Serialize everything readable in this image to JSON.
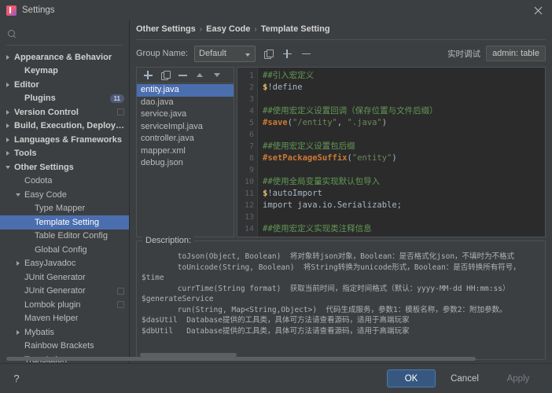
{
  "window": {
    "title": "Settings",
    "app_icon": "intellij-logo-icon",
    "close_icon": "close-icon"
  },
  "sidebar": {
    "search_placeholder": "",
    "search_icon": "search-icon",
    "items": [
      {
        "label": "Appearance & Behavior",
        "indent": 0,
        "arrow": "right",
        "bold": true
      },
      {
        "label": "Keymap",
        "indent": 1,
        "arrow": "none",
        "bold": true
      },
      {
        "label": "Editor",
        "indent": 0,
        "arrow": "right",
        "bold": true
      },
      {
        "label": "Plugins",
        "indent": 1,
        "arrow": "none",
        "bold": true,
        "badge": "11"
      },
      {
        "label": "Version Control",
        "indent": 0,
        "arrow": "right",
        "bold": true,
        "icon": "copy-icon"
      },
      {
        "label": "Build, Execution, Deployment",
        "indent": 0,
        "arrow": "right",
        "bold": true
      },
      {
        "label": "Languages & Frameworks",
        "indent": 0,
        "arrow": "right",
        "bold": true
      },
      {
        "label": "Tools",
        "indent": 0,
        "arrow": "right",
        "bold": true
      },
      {
        "label": "Other Settings",
        "indent": 0,
        "arrow": "down",
        "bold": true
      },
      {
        "label": "Codota",
        "indent": 1,
        "arrow": "none"
      },
      {
        "label": "Easy Code",
        "indent": 1,
        "arrow": "down"
      },
      {
        "label": "Type Mapper",
        "indent": 2,
        "arrow": "none"
      },
      {
        "label": "Template Setting",
        "indent": 2,
        "arrow": "none",
        "selected": true
      },
      {
        "label": "Table Editor Config",
        "indent": 2,
        "arrow": "none"
      },
      {
        "label": "Global Config",
        "indent": 2,
        "arrow": "none"
      },
      {
        "label": "EasyJavadoc",
        "indent": 1,
        "arrow": "right"
      },
      {
        "label": "JUnit Generator",
        "indent": 1,
        "arrow": "none"
      },
      {
        "label": "JUnit Generator",
        "indent": 1,
        "arrow": "none",
        "icon": "copy-icon"
      },
      {
        "label": "Lombok plugin",
        "indent": 1,
        "arrow": "none",
        "icon": "copy-icon"
      },
      {
        "label": "Maven Helper",
        "indent": 1,
        "arrow": "none"
      },
      {
        "label": "Mybatis",
        "indent": 1,
        "arrow": "right"
      },
      {
        "label": "Rainbow Brackets",
        "indent": 1,
        "arrow": "none"
      },
      {
        "label": "Translation",
        "indent": 1,
        "arrow": "none"
      }
    ]
  },
  "breadcrumb": {
    "items": [
      "Other Settings",
      "Easy Code",
      "Template Setting"
    ],
    "separator": "›"
  },
  "group_row": {
    "label": "Group Name:",
    "selected_group": "Default",
    "options": [
      "Default"
    ],
    "buttons": [
      {
        "name": "copy-group-button",
        "icon": "copy-icon"
      },
      {
        "name": "add-group-button",
        "icon": "plus-icon"
      },
      {
        "name": "remove-group-button",
        "icon": "minus-icon"
      }
    ],
    "debug_label": "实时调试",
    "debug_value": "admin: table"
  },
  "file_list": {
    "toolbar": [
      {
        "name": "add-file-button",
        "icon": "plus-icon"
      },
      {
        "name": "copy-file-button",
        "icon": "copy-icon"
      },
      {
        "name": "remove-file-button",
        "icon": "minus-icon"
      },
      {
        "name": "move-up-button",
        "icon": "arrow-up-icon"
      },
      {
        "name": "move-down-button",
        "icon": "arrow-down-icon"
      }
    ],
    "items": [
      {
        "label": "entity.java",
        "selected": true
      },
      {
        "label": "dao.java"
      },
      {
        "label": "service.java"
      },
      {
        "label": "serviceImpl.java"
      },
      {
        "label": "controller.java"
      },
      {
        "label": "mapper.xml"
      },
      {
        "label": "debug.json"
      }
    ]
  },
  "editor": {
    "lines": [
      {
        "n": 1,
        "tokens": [
          {
            "t": "##引入宏定义",
            "c": "c-comment"
          }
        ]
      },
      {
        "n": 2,
        "tokens": [
          {
            "t": "$",
            "c": "c-var"
          },
          {
            "t": "!define",
            "c": "c-plain"
          }
        ]
      },
      {
        "n": 3,
        "tokens": []
      },
      {
        "n": 4,
        "tokens": [
          {
            "t": "##使用宏定义设置回调（保存位置与文件后缀）",
            "c": "c-comment"
          }
        ]
      },
      {
        "n": 5,
        "tokens": [
          {
            "t": "#save",
            "c": "c-dir"
          },
          {
            "t": "(",
            "c": "c-plain"
          },
          {
            "t": "\"/entity\"",
            "c": "c-str"
          },
          {
            "t": ", ",
            "c": "c-plain"
          },
          {
            "t": "\".java\"",
            "c": "c-str"
          },
          {
            "t": ")",
            "c": "c-plain"
          }
        ]
      },
      {
        "n": 6,
        "tokens": []
      },
      {
        "n": 7,
        "tokens": [
          {
            "t": "##使用宏定义设置包后缀",
            "c": "c-comment"
          }
        ]
      },
      {
        "n": 8,
        "tokens": [
          {
            "t": "#setPackageSuffix",
            "c": "c-dir"
          },
          {
            "t": "(",
            "c": "c-plain"
          },
          {
            "t": "\"entity\"",
            "c": "c-str"
          },
          {
            "t": ")",
            "c": "c-plain"
          }
        ]
      },
      {
        "n": 9,
        "tokens": []
      },
      {
        "n": 10,
        "tokens": [
          {
            "t": "##使用全局变量实现默认包导入",
            "c": "c-comment"
          }
        ]
      },
      {
        "n": 11,
        "tokens": [
          {
            "t": "$",
            "c": "c-var"
          },
          {
            "t": "!autoImport",
            "c": "c-plain"
          }
        ]
      },
      {
        "n": 12,
        "tokens": [
          {
            "t": "import java.io.Serializable;",
            "c": "c-plain"
          }
        ]
      },
      {
        "n": 13,
        "tokens": []
      },
      {
        "n": 14,
        "tokens": [
          {
            "t": "##使用宏定义实现类注释信息",
            "c": "c-comment"
          }
        ]
      }
    ]
  },
  "description": {
    "title": "Description:",
    "text": "        toJson(Object, Boolean)  将对象转json对象，Boolean：是否格式化json，不填时为不格式\n        toUnicode(String, Boolean)  将String转换为unicode形式，Boolean：是否转换所有符号，\n$time\n        currTime(String format)  获取当前时间，指定时间格式（默认：yyyy-MM-dd HH:mm:ss）\n$generateService\n        run(String, Map<String,Object>)  代码生成服务，参数1：模板名称，参数2：附加参数。\n$dasUtil  Database提供的工具类，具体可方法请查看源码，适用于高端玩家\n$dbUtil   Database提供的工具类，具体可方法请查看源码，适用于高端玩家"
  },
  "footer": {
    "help_label": "?",
    "ok_label": "OK",
    "cancel_label": "Cancel",
    "apply_label": "Apply"
  },
  "colors": {
    "accent": "#4b6eaf",
    "primary_button": "#365880",
    "background": "#3c3f41",
    "editor_background": "#2b2b2b",
    "comment": "#629755",
    "variable": "#e8bf6a",
    "string": "#6a8759",
    "directive": "#cc7832"
  }
}
